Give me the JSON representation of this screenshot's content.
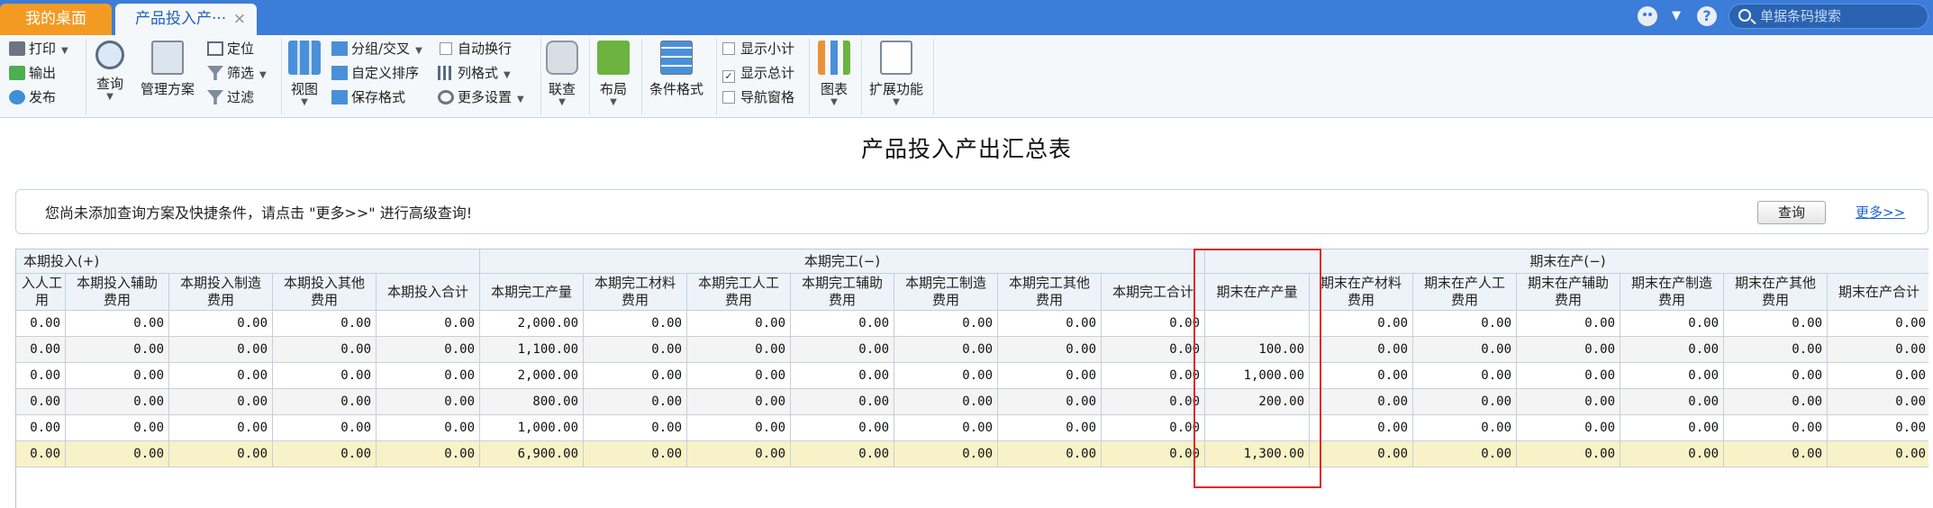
{
  "header": {
    "tabs": [
      {
        "label": "我的桌面"
      },
      {
        "label": "产品投入产···",
        "close": "×"
      }
    ],
    "search_placeholder": "单据条码搜索"
  },
  "toolbar": {
    "print": "打印",
    "export": "输出",
    "publish": "发布",
    "query": "查询",
    "manage_scheme": "管理方案",
    "locate": "定位",
    "filter_select": "筛选",
    "filter": "过滤",
    "view": "视图",
    "group_cross": "分组/交叉",
    "custom_sort": "自定义排序",
    "save_format": "保存格式",
    "auto_wrap": "自动换行",
    "column_format": "列格式",
    "more_settings": "更多设置",
    "link_query": "联查",
    "layout": "布局",
    "cond_format": "条件格式",
    "show_subtotal": "显示小计",
    "show_total": "显示总计",
    "nav_pane": "导航窗格",
    "chart": "图表",
    "extend": "扩展功能"
  },
  "report": {
    "title": "产品投入产出汇总表"
  },
  "query_panel": {
    "hint": "您尚未添加查询方案及快捷条件，请点击 \"更多>>\" 进行高级查询!",
    "query_button": "查询",
    "more_link": "更多>>"
  },
  "grid": {
    "groups": [
      {
        "label": "本期投入(+)"
      },
      {
        "label": "本期完工(−)"
      },
      {
        "label": "期末在产(−)"
      }
    ],
    "columns": [
      {
        "label": "入人工\n用"
      },
      {
        "label": "本期投入辅助\n费用"
      },
      {
        "label": "本期投入制造\n费用"
      },
      {
        "label": "本期投入其他\n费用"
      },
      {
        "label": "本期投入合计"
      },
      {
        "label": "本期完工产量"
      },
      {
        "label": "本期完工材料\n费用"
      },
      {
        "label": "本期完工人工\n费用"
      },
      {
        "label": "本期完工辅助\n费用"
      },
      {
        "label": "本期完工制造\n费用"
      },
      {
        "label": "本期完工其他\n费用"
      },
      {
        "label": "本期完工合计"
      },
      {
        "label": "期末在产产量"
      },
      {
        "label": "期末在产材料\n费用"
      },
      {
        "label": "期末在产人工\n费用"
      },
      {
        "label": "期末在产辅助\n费用"
      },
      {
        "label": "期末在产制造\n费用"
      },
      {
        "label": "期末在产其他\n费用"
      },
      {
        "label": "期末在产合计"
      }
    ],
    "rows": [
      [
        "0.00",
        "0.00",
        "0.00",
        "0.00",
        "0.00",
        "2,000.00",
        "0.00",
        "0.00",
        "0.00",
        "0.00",
        "0.00",
        "0.00",
        "",
        "0.00",
        "0.00",
        "0.00",
        "0.00",
        "0.00",
        "0.00"
      ],
      [
        "0.00",
        "0.00",
        "0.00",
        "0.00",
        "0.00",
        "1,100.00",
        "0.00",
        "0.00",
        "0.00",
        "0.00",
        "0.00",
        "0.00",
        "100.00",
        "0.00",
        "0.00",
        "0.00",
        "0.00",
        "0.00",
        "0.00"
      ],
      [
        "0.00",
        "0.00",
        "0.00",
        "0.00",
        "0.00",
        "2,000.00",
        "0.00",
        "0.00",
        "0.00",
        "0.00",
        "0.00",
        "0.00",
        "1,000.00",
        "0.00",
        "0.00",
        "0.00",
        "0.00",
        "0.00",
        "0.00"
      ],
      [
        "0.00",
        "0.00",
        "0.00",
        "0.00",
        "0.00",
        "800.00",
        "0.00",
        "0.00",
        "0.00",
        "0.00",
        "0.00",
        "0.00",
        "200.00",
        "0.00",
        "0.00",
        "0.00",
        "0.00",
        "0.00",
        "0.00"
      ],
      [
        "0.00",
        "0.00",
        "0.00",
        "0.00",
        "0.00",
        "1,000.00",
        "0.00",
        "0.00",
        "0.00",
        "0.00",
        "0.00",
        "0.00",
        "",
        "0.00",
        "0.00",
        "0.00",
        "0.00",
        "0.00",
        "0.00"
      ]
    ],
    "total_row": [
      "0.00",
      "0.00",
      "0.00",
      "0.00",
      "0.00",
      "6,900.00",
      "0.00",
      "0.00",
      "0.00",
      "0.00",
      "0.00",
      "0.00",
      "1,300.00",
      "0.00",
      "0.00",
      "0.00",
      "0.00",
      "0.00",
      "0.00"
    ]
  },
  "colors": {
    "topbar": "#3b7dd8",
    "desktop_tab": "#f39a23",
    "total_row": "#f8f2c8",
    "highlight": "#e02a2a"
  }
}
